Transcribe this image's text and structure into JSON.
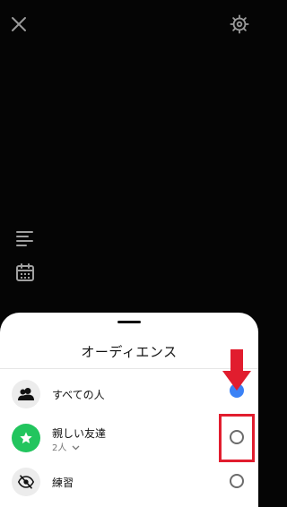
{
  "header": {
    "close_icon": "close-icon",
    "settings_icon": "gear-icon"
  },
  "left_tools": [
    {
      "icon": "text-align-icon"
    },
    {
      "icon": "calendar-icon"
    }
  ],
  "audience_sheet": {
    "title": "オーディエンス",
    "options": [
      {
        "label": "すべての人",
        "icon": "people-icon",
        "selected": true,
        "color": "#3b82f6"
      },
      {
        "label": "親しい友達",
        "sublabel": "2人",
        "icon": "star-icon",
        "selected": false,
        "color": "#22c55e"
      },
      {
        "label": "練習",
        "icon": "eye-off-icon",
        "selected": false
      }
    ]
  },
  "annotation": {
    "color": "#e11d2e"
  }
}
